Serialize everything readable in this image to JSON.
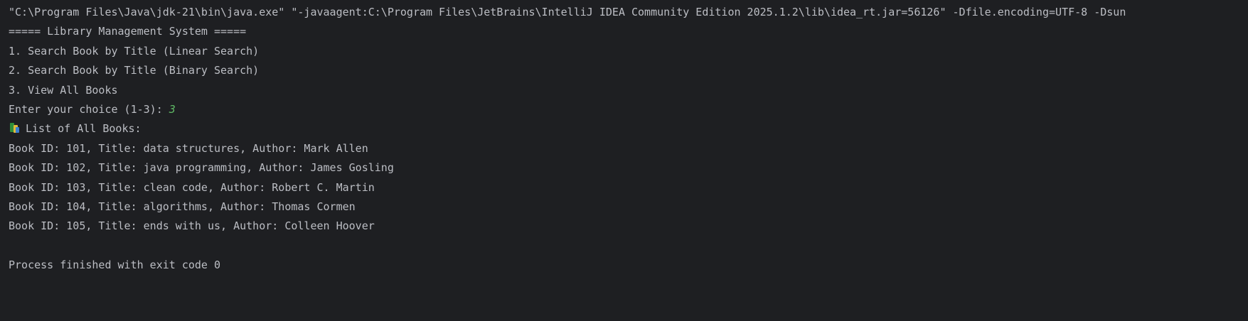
{
  "console": {
    "command_line": "\"C:\\Program Files\\Java\\jdk-21\\bin\\java.exe\" \"-javaagent:C:\\Program Files\\JetBrains\\IntelliJ IDEA Community Edition 2025.1.2\\lib\\idea_rt.jar=56126\" -Dfile.encoding=UTF-8 -Dsun",
    "menu_header": "===== Library Management System =====",
    "menu_items": [
      "1. Search Book by Title (Linear Search)",
      "2. Search Book by Title (Binary Search)",
      "3. View All Books"
    ],
    "prompt": "Enter your choice (1-3): ",
    "user_input": "3",
    "list_header_icon": "books-icon",
    "list_header": "List of All Books:",
    "books": [
      "Book ID: 101, Title: data structures, Author: Mark Allen",
      "Book ID: 102, Title: java programming, Author: James Gosling",
      "Book ID: 103, Title: clean code, Author: Robert C. Martin",
      "Book ID: 104, Title: algorithms, Author: Thomas Cormen",
      "Book ID: 105, Title: ends with us, Author: Colleen Hoover"
    ],
    "exit_message": "Process finished with exit code 0"
  },
  "colors": {
    "background": "#1e1f22",
    "text": "#bcbec4",
    "user_input": "#5fb865"
  }
}
